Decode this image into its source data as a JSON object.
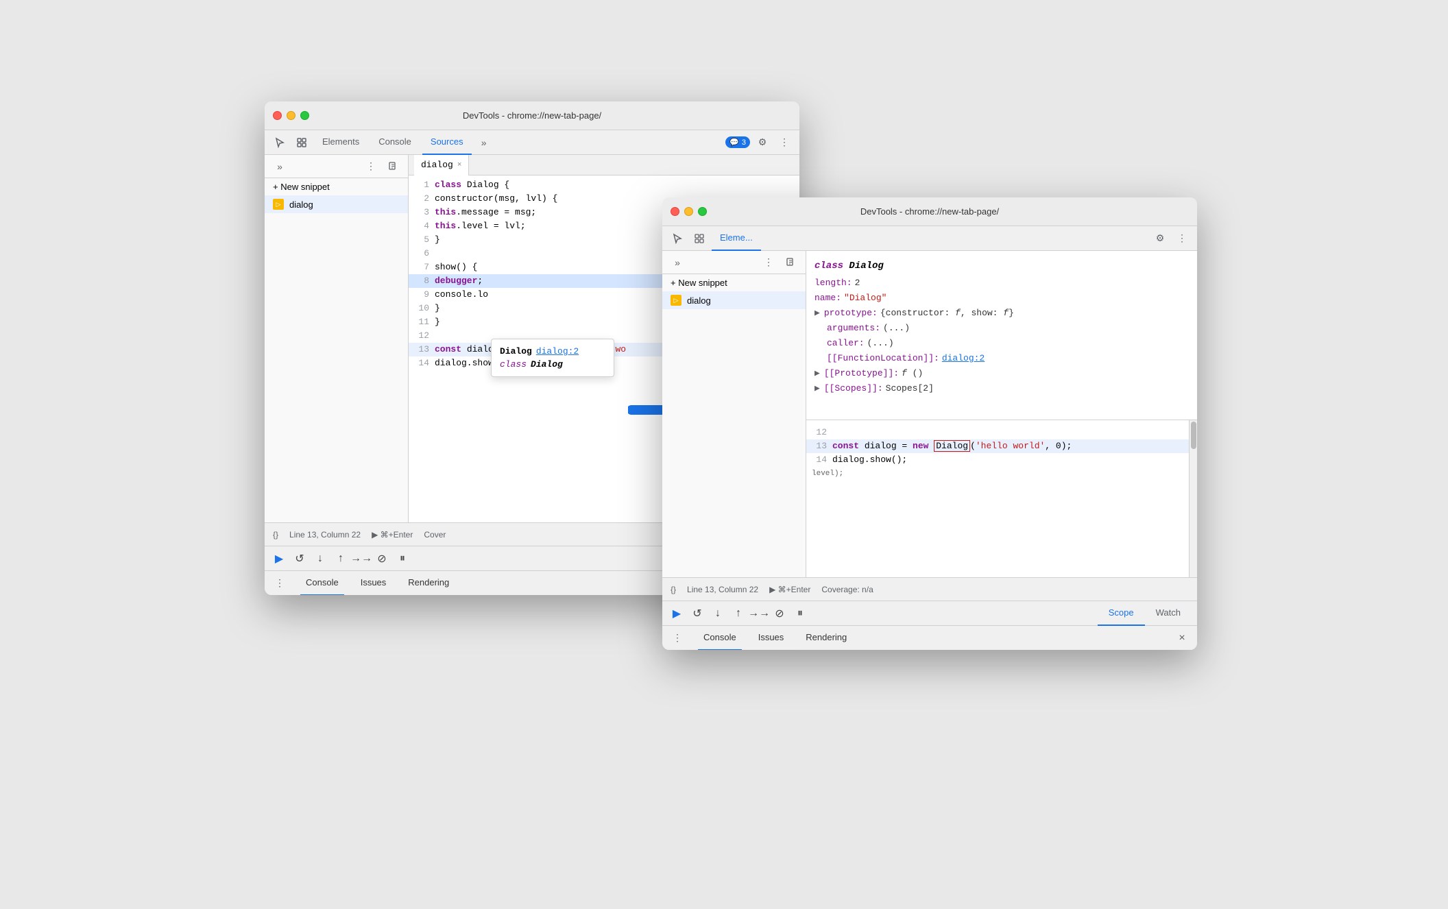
{
  "scene": {
    "bg_color": "#e8e8e8"
  },
  "window_back": {
    "titlebar": {
      "title": "DevTools - chrome://new-tab-page/"
    },
    "toolbar": {
      "tabs": [
        "Elements",
        "Console",
        "Sources",
        "more"
      ],
      "active_tab": "Sources",
      "badge_count": "3"
    },
    "sidebar": {
      "new_snippet_label": "+ New snippet",
      "file_item": "dialog"
    },
    "editor": {
      "filename": "dialog",
      "tab_label": "dialog",
      "lines": [
        {
          "num": 1,
          "text": "class Dialog {"
        },
        {
          "num": 2,
          "text": "  constructor(msg, lvl) {"
        },
        {
          "num": 3,
          "text": "    this.message = msg;"
        },
        {
          "num": 4,
          "text": "    this.level = lvl;"
        },
        {
          "num": 5,
          "text": "  }"
        },
        {
          "num": 6,
          "text": ""
        },
        {
          "num": 7,
          "text": "  show() {"
        },
        {
          "num": 8,
          "text": "    debugger;"
        },
        {
          "num": 9,
          "text": "    console.lo"
        },
        {
          "num": 10,
          "text": "  }"
        },
        {
          "num": 11,
          "text": "}"
        },
        {
          "num": 12,
          "text": ""
        },
        {
          "num": 13,
          "text": "const dialog = new Dialog('hello wo"
        },
        {
          "num": 14,
          "text": "dialog.show();"
        }
      ]
    },
    "statusbar": {
      "format": "{}",
      "position": "Line 13, Column 22",
      "run_label": "▶ ⌘+Enter",
      "coverage": "Cover"
    },
    "debug_toolbar": {
      "scope_label": "Scope",
      "watch_label": "Watch"
    },
    "bottom_bar": {
      "tabs": [
        "Console",
        "Issues",
        "Rendering"
      ]
    },
    "hover_card": {
      "line1_name": "Dialog",
      "line1_link": "dialog:2",
      "line2": "class Dialog"
    }
  },
  "arrow": {
    "color": "#1a73e8"
  },
  "window_front": {
    "titlebar": {
      "title": "DevTools - chrome://new-tab-page/"
    },
    "toolbar": {
      "tabs": [
        "Elements (partial)",
        "more"
      ],
      "active_tab": "Elements"
    },
    "sidebar": {
      "new_snippet_label": "+ New snippet",
      "file_item": "dialog"
    },
    "object_panel": {
      "class_name": "class Dialog",
      "properties": [
        {
          "key": "length:",
          "val": "2"
        },
        {
          "key": "name:",
          "val": "\"Dialog\""
        },
        {
          "key": "prototype:",
          "val": "{constructor: f, show: f}"
        },
        {
          "key": "arguments:",
          "val": "(...)"
        },
        {
          "key": "caller:",
          "val": "(...)"
        },
        {
          "key": "[[FunctionLocation]]:",
          "val": "dialog:2",
          "is_link": true
        },
        {
          "key": "[[Prototype]]:",
          "val": "f ()"
        },
        {
          "key": "[[Scopes]]:",
          "val": "Scopes[2]"
        }
      ]
    },
    "editor": {
      "lines": [
        {
          "num": 12,
          "text": ""
        },
        {
          "num": 13,
          "text": "const dialog = new Dialog('hello world', 0);"
        },
        {
          "num": 14,
          "text": "dialog.show();"
        }
      ]
    },
    "statusbar": {
      "format": "{}",
      "position": "Line 13, Column 22",
      "run_label": "▶ ⌘+Enter",
      "coverage": "Coverage: n/a"
    },
    "debug_toolbar": {
      "scope_label": "Scope",
      "watch_label": "Watch"
    },
    "bottom_bar": {
      "tabs": [
        "Console",
        "Issues",
        "Rendering"
      ],
      "close_icon": "×"
    }
  }
}
